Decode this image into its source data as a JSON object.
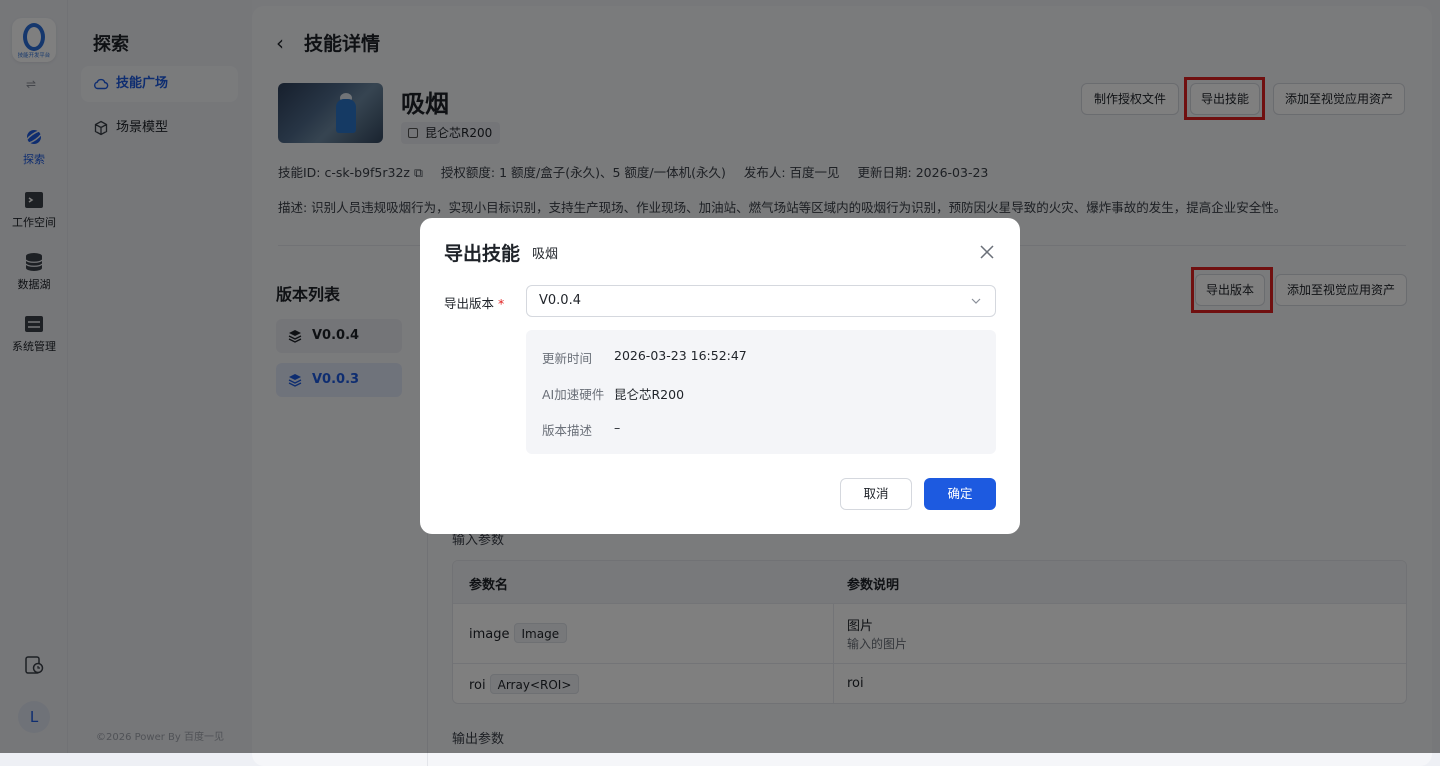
{
  "app": {
    "logo_text": "技能开发平台"
  },
  "rail": {
    "items": [
      {
        "label": "探索"
      },
      {
        "label": "工作空间"
      },
      {
        "label": "数据湖"
      },
      {
        "label": "系统管理"
      }
    ],
    "avatar": "L"
  },
  "sidebar": {
    "title": "探索",
    "items": [
      {
        "label": "技能广场"
      },
      {
        "label": "场景模型"
      }
    ],
    "copyright": "©2026 Power By 百度一见"
  },
  "page": {
    "title": "技能详情",
    "skill_name": "吸烟",
    "hardware_tag": "昆仑芯R200",
    "actions": {
      "make_license": "制作授权文件",
      "export_skill": "导出技能",
      "add_asset": "添加至视觉应用资产"
    },
    "meta": {
      "skill_id": "技能ID:  c-sk-b9f5r32z",
      "quota": "授权额度:  1 额度/盒子(永久)、5 额度/一体机(永久)",
      "publisher": "发布人:  百度一见",
      "updated": "更新日期:  2026-03-23"
    },
    "description": "描述:  识别人员违规吸烟行为，实现小目标识别，支持生产现场、作业现场、加油站、燃气场站等区域内的吸烟行为识别，预防因火星导致的火灾、爆炸事故的发生，提高企业安全性。"
  },
  "versions": {
    "title": "版本列表",
    "items": [
      {
        "label": "V0.0.4"
      },
      {
        "label": "V0.0.3"
      }
    ],
    "actions": {
      "export_version": "导出版本",
      "add_asset": "添加至视觉应用资产"
    }
  },
  "params": {
    "input_title": "输入参数",
    "output_title": "输出参数",
    "headers": {
      "name": "参数名",
      "desc": "参数说明"
    },
    "rows": [
      {
        "name": "image",
        "type": "Image",
        "desc": "图片",
        "desc2": "输入的图片"
      },
      {
        "name": "roi",
        "type": "Array<ROI>",
        "desc": "roi"
      }
    ]
  },
  "modal": {
    "title": "导出技能",
    "subtitle": "吸烟",
    "version_label": "导出版本",
    "required_mark": "*",
    "version_value": "V0.0.4",
    "info": [
      {
        "key": "更新时间",
        "value": "2026-03-23 16:52:47"
      },
      {
        "key": "AI加速硬件",
        "value": "昆仑芯R200"
      },
      {
        "key": "版本描述",
        "value": "–"
      }
    ],
    "cancel": "取消",
    "ok": "确定"
  },
  "colors": {
    "primary": "#1d5ae0",
    "highlight": "#e02020"
  }
}
